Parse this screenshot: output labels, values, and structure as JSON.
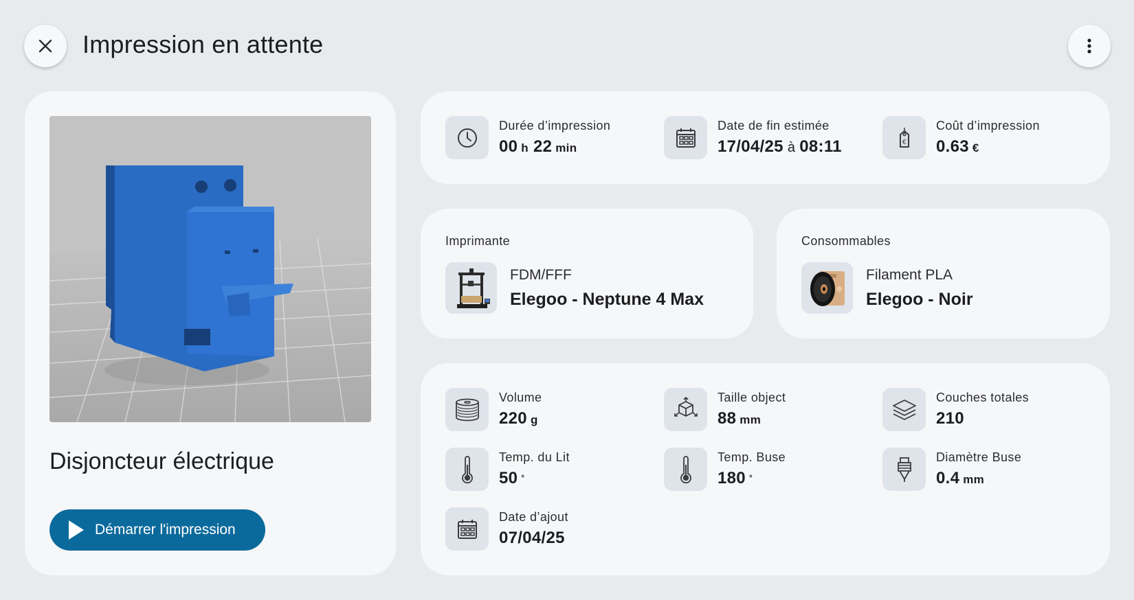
{
  "header": {
    "title": "Impression en attente",
    "close_icon": "close-icon",
    "more_icon": "more-vertical-icon"
  },
  "model": {
    "name": "Disjoncteur électrique",
    "preview_icon": "3d-model-preview",
    "start_label": "Démarrer l'impression",
    "accent": "#0b6a9c"
  },
  "summary": {
    "duration": {
      "label": "Durée d’impression",
      "hours": "00",
      "h_unit": "h",
      "minutes": "22",
      "min_unit": "min",
      "icon": "clock-icon"
    },
    "end_date": {
      "label": "Date de fin estimée",
      "date": "17/04/25",
      "sep": "à",
      "time": "08:11",
      "icon": "calendar-icon"
    },
    "cost": {
      "label": "Coût d’impression",
      "value": "0.63",
      "unit": "€",
      "icon": "price-tag-icon"
    }
  },
  "printer": {
    "section_label": "Imprimante",
    "type": "FDM/FFF",
    "name": "Elegoo - Neptune 4 Max",
    "icon": "printer-icon"
  },
  "consumables": {
    "section_label": "Consommables",
    "type": "Filament PLA",
    "name": "Elegoo - Noir",
    "icon": "filament-spool-icon"
  },
  "specs": {
    "volume": {
      "label": "Volume",
      "value": "220",
      "unit": "g",
      "icon": "spool-icon"
    },
    "size": {
      "label": "Taille object",
      "value": "88",
      "unit": "mm",
      "icon": "cube-axes-icon"
    },
    "layers": {
      "label": "Couches totales",
      "value": "210",
      "icon": "layers-icon"
    },
    "bed_temp": {
      "label": "Temp. du Lit",
      "value": "50",
      "unit": "°",
      "icon": "thermometer-icon"
    },
    "nozzle_temp": {
      "label": "Temp. Buse",
      "value": "180",
      "unit": "°",
      "icon": "thermometer-icon"
    },
    "nozzle_diam": {
      "label": "Diamètre Buse",
      "value": "0.4",
      "unit": "mm",
      "icon": "nozzle-icon"
    },
    "added_date": {
      "label": "Date d’ajout",
      "value": "07/04/25",
      "icon": "calendar-icon"
    }
  }
}
